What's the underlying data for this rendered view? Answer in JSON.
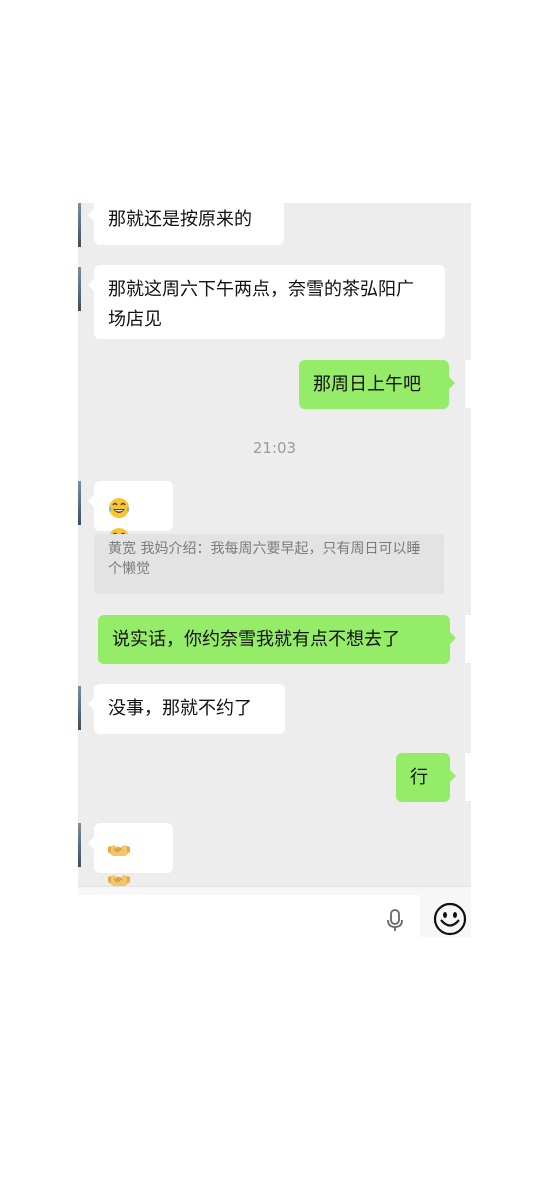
{
  "messages": [
    {
      "id": "m1",
      "side": "in",
      "text": "那就还是按原来的"
    },
    {
      "id": "m2",
      "side": "in",
      "text": "那就这周六下午两点，奈雪的茶弘阳广场店见"
    },
    {
      "id": "m3",
      "side": "out",
      "text": "那周日上午吧"
    },
    {
      "id": "m4",
      "side": "in",
      "text": "😂😂"
    },
    {
      "id": "m5",
      "side": "out",
      "text": "说实话，你约奈雪我就有点不想去了"
    },
    {
      "id": "m6",
      "side": "in",
      "text": "没事，那就不约了"
    },
    {
      "id": "m7",
      "side": "out",
      "text": "行"
    },
    {
      "id": "m8",
      "side": "in",
      "text": "🤝🤝"
    }
  ],
  "timestamp": "21:03",
  "quote": {
    "text": "黄宽  我妈介绍：我每周六要早起，只有周日可以睡个懒觉"
  },
  "input_bar": {
    "mic_icon": "microphone-icon",
    "emoji_icon": "smiley-face-icon"
  },
  "colors": {
    "chat_bg": "#ededed",
    "incoming_bubble": "#ffffff",
    "outgoing_bubble": "#95ec69",
    "timestamp": "#9b9b9b",
    "quote_bg": "#e3e3e3"
  }
}
